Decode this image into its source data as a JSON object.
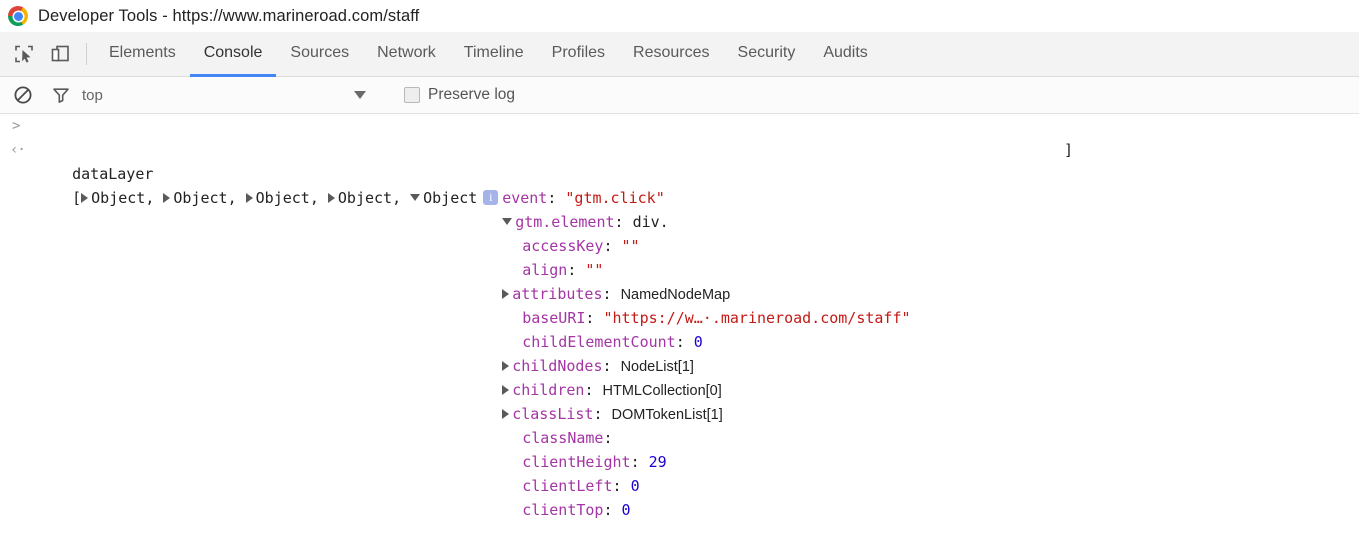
{
  "window": {
    "title": "Developer Tools - https://www.marineroad.com/staff",
    "logo_icon": "chrome-logo-icon"
  },
  "toolbar": {
    "inspect_icon": "inspect-element-icon",
    "device_icon": "device-toolbar-icon",
    "tabs": [
      {
        "label": "Elements",
        "active": false
      },
      {
        "label": "Console",
        "active": true
      },
      {
        "label": "Sources",
        "active": false
      },
      {
        "label": "Network",
        "active": false
      },
      {
        "label": "Timeline",
        "active": false
      },
      {
        "label": "Profiles",
        "active": false
      },
      {
        "label": "Resources",
        "active": false
      },
      {
        "label": "Security",
        "active": false
      },
      {
        "label": "Audits",
        "active": false
      }
    ],
    "active_tab_underline_color": "#4285f4"
  },
  "filter_bar": {
    "clear_icon": "clear-console-icon",
    "filter_icon": "filter-funnel-icon",
    "context_value": "top",
    "context_caret_icon": "chevron-down-icon",
    "preserve_log_label": "Preserve log",
    "preserve_log_checked": false
  },
  "console": {
    "prompt_glyph": ">",
    "result_glyph": "‹·",
    "input_expression": "dataLayer",
    "result": {
      "open_bracket": "[",
      "close_bracket": "]",
      "collapsed_objects": [
        "Object",
        "Object",
        "Object",
        "Object"
      ],
      "expanded_object": "Object",
      "separator": ", ",
      "info_badge": "i",
      "info_badge_color": "#a5b4e8"
    },
    "properties": [
      {
        "indent": 1,
        "toggle": "none",
        "key": "event",
        "sep": ": ",
        "value": "\"gtm.click\"",
        "value_type": "string"
      },
      {
        "indent": 1,
        "toggle": "open",
        "key": "gtm.element",
        "sep": ": ",
        "value": "div.",
        "value_type": "element"
      },
      {
        "indent": 2,
        "toggle": "none",
        "key": "accessKey",
        "sep": ": ",
        "value": "\"\"",
        "value_type": "string"
      },
      {
        "indent": 2,
        "toggle": "none",
        "key": "align",
        "sep": ": ",
        "value": "\"\"",
        "value_type": "string"
      },
      {
        "indent": 2,
        "toggle": "closed",
        "key": "attributes",
        "sep": ": ",
        "value": "NamedNodeMap",
        "value_type": "native"
      },
      {
        "indent": 2,
        "toggle": "none",
        "key": "baseURI",
        "sep": ": ",
        "value": "\"https://w…·.marineroad.com/staff\"",
        "value_type": "string"
      },
      {
        "indent": 2,
        "toggle": "none",
        "key": "childElementCount",
        "sep": ": ",
        "value": "0",
        "value_type": "number"
      },
      {
        "indent": 2,
        "toggle": "closed",
        "key": "childNodes",
        "sep": ": ",
        "value": "NodeList[1]",
        "value_type": "native"
      },
      {
        "indent": 2,
        "toggle": "closed",
        "key": "children",
        "sep": ": ",
        "value": "HTMLCollection[0]",
        "value_type": "native"
      },
      {
        "indent": 2,
        "toggle": "closed",
        "key": "classList",
        "sep": ": ",
        "value": "DOMTokenList[1]",
        "value_type": "native"
      },
      {
        "indent": 2,
        "toggle": "none",
        "key": "className",
        "sep": ":",
        "value": "",
        "value_type": "string"
      },
      {
        "indent": 2,
        "toggle": "none",
        "key": "clientHeight",
        "sep": ": ",
        "value": "29",
        "value_type": "number"
      },
      {
        "indent": 2,
        "toggle": "none",
        "key": "clientLeft",
        "sep": ": ",
        "value": "0",
        "value_type": "number"
      },
      {
        "indent": 2,
        "toggle": "none",
        "key": "clientTop",
        "sep": ": ",
        "value": "0",
        "value_type": "number"
      }
    ]
  }
}
